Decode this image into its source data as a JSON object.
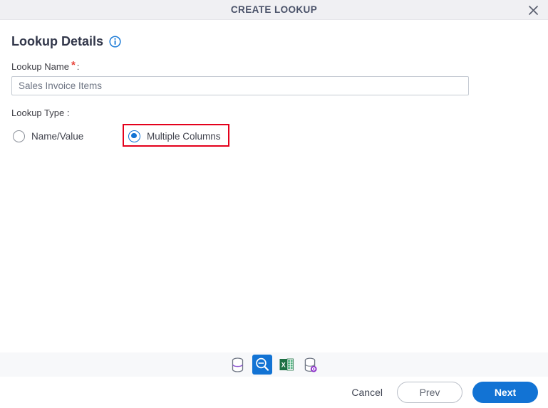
{
  "window": {
    "title": "CREATE LOOKUP",
    "close_icon": "close-icon"
  },
  "section": {
    "title": "Lookup Details",
    "info_icon": "info-icon"
  },
  "form": {
    "name_label": "Lookup Name",
    "required_marker": "*",
    "label_colon": ":",
    "name_value": "Sales Invoice Items",
    "name_placeholder": "Lookup Name",
    "type_label": "Lookup Type :",
    "options": [
      {
        "label": "Name/Value",
        "selected": false
      },
      {
        "label": "Multiple Columns",
        "selected": true
      }
    ]
  },
  "icon_bar": {
    "items": [
      {
        "name": "database-icon",
        "active": false
      },
      {
        "name": "lookup-search-icon",
        "active": true
      },
      {
        "name": "excel-icon",
        "active": false
      },
      {
        "name": "database-settings-icon",
        "active": false
      }
    ]
  },
  "footer": {
    "cancel_label": "Cancel",
    "prev_label": "Prev",
    "next_label": "Next"
  },
  "colors": {
    "accent": "#1273d4",
    "highlight": "#e4001b",
    "required": "#e8443a",
    "titlebar_bg": "#f0f0f3",
    "strip_bg": "#f7f8fa",
    "excel_green": "#1d7044",
    "gear_purple": "#8b2fc9"
  }
}
